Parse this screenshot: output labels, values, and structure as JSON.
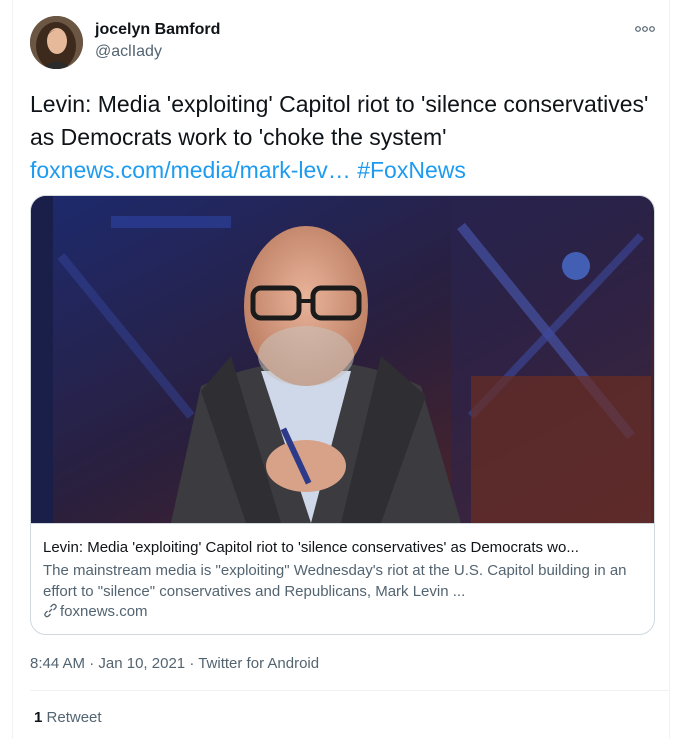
{
  "user": {
    "name": "jocelyn Bamford",
    "handle": "@aclIady"
  },
  "tweet": {
    "text": "Levin: Media 'exploiting' Capitol riot to 'silence conservatives' as Democrats work to 'choke the system'",
    "link_text": "foxnews.com/media/mark-lev…",
    "hashtag": "#FoxNews"
  },
  "card": {
    "title": "Levin: Media 'exploiting' Capitol riot to 'silence conservatives' as Democrats wo...",
    "description": "The mainstream media is \"exploiting\" Wednesday's riot at the U.S. Capitol building in an effort to \"silence\" conservatives and Republicans, Mark Levin ...",
    "domain": "foxnews.com",
    "link_icon": "link-icon"
  },
  "meta": {
    "time": "8:44 AM",
    "sep1": "·",
    "date": "Jan 10, 2021",
    "sep2": "·",
    "source": "Twitter for Android"
  },
  "stats": {
    "retweet_count": "1",
    "retweet_label": "Retweet"
  },
  "icons": {
    "more": "more-options-icon",
    "link": "link-icon"
  },
  "colors": {
    "link": "#1d9bf0",
    "secondary_text": "#536471",
    "primary_text": "#0f1419",
    "border": "#cfd9de"
  }
}
